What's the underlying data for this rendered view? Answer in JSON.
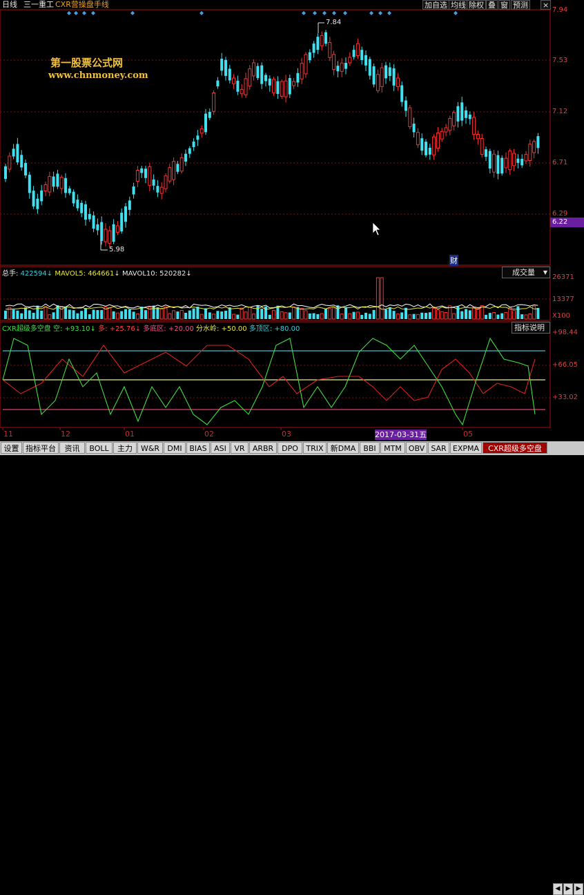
{
  "header": {
    "period": "日线",
    "stock_name": "三一重工",
    "indicator_name": "CXR营操盘手线",
    "buttons": [
      "加自选",
      "均线",
      "除权",
      "叠",
      "窗",
      "预测"
    ],
    "close_glyph": "×"
  },
  "watermark": {
    "line1": "第一股票公式网",
    "line2": "www.chnmoney.com"
  },
  "price_axis": {
    "labels": [
      "7.94",
      "7.53",
      "7.12",
      "6.71",
      "6.29"
    ],
    "current_price": "6.22",
    "min_value": 6.29,
    "max_value": 7.94
  },
  "annotations": {
    "high_label": "7.84",
    "low_label": "5.98",
    "finance_marker": "财"
  },
  "volume_pane": {
    "total_hand_label": "总手:",
    "total_hand_value": "422594",
    "mavol5_label": "MAVOL5:",
    "mavol5_value": "464661",
    "mavol10_label": "MAVOL10:",
    "mavol10_value": "520282",
    "arrow_down": "↓",
    "dropdown": "成交量",
    "axis_labels": [
      "26371",
      "13377",
      "X100"
    ]
  },
  "indicator_pane": {
    "name": "CXR超级多空盘",
    "kong_label": "空:",
    "kong_value": "+93.10",
    "duo_label": "多:",
    "duo_value": "+25.76",
    "bottom_label": "多底区:",
    "bottom_value": "+20.00",
    "water_label": "分水岭:",
    "water_value": "+50.00",
    "top_label": "多顶区:",
    "top_value": "+80.00",
    "help_button": "指标说明",
    "axis_labels": [
      "+98.44",
      "+66.05",
      "+33.02"
    ]
  },
  "x_axis": {
    "labels": [
      "11",
      "12",
      "01",
      "02",
      "03",
      "05"
    ],
    "cursor_date": "2017-03-31五"
  },
  "tabs": [
    "设置",
    "指标平台",
    "资讯",
    "BOLL",
    "主力",
    "W&R",
    "DMI",
    "BIAS",
    "ASI",
    "VR",
    "ARBR",
    "DPO",
    "TRIX",
    "新DMA",
    "BBI",
    "MTM",
    "OBV",
    "SAR",
    "EXPMA",
    "CXR超级多空盘"
  ],
  "nav": [
    "◀",
    "▶",
    "▶"
  ],
  "colors": {
    "up": "#ff3030",
    "down": "#40e0f0",
    "grid": "#a01010",
    "kong_line": "#40e040",
    "duo_line": "#e02020"
  }
}
